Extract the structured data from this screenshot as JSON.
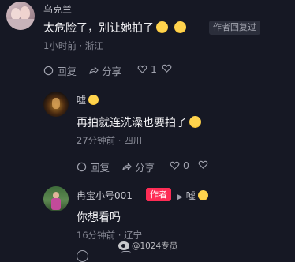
{
  "comments": [
    {
      "username": "乌克兰",
      "text": "太危险了，别让她拍了",
      "emojis": [
        "laughing-crying-emoji",
        "laughing-crying-emoji"
      ],
      "author_badge": "作者回复过",
      "time": "1小时前 · 浙江",
      "actions": {
        "reply": "回复",
        "share": "分享",
        "likes": "1"
      }
    },
    {
      "username": "嘘",
      "text": "再拍就连洗澡也要拍了",
      "emojis": [
        "smile-emoji"
      ],
      "time": "27分钟前 · 四川",
      "actions": {
        "reply": "回复",
        "share": "分享",
        "likes": "0"
      }
    },
    {
      "username": "冉宝小号001",
      "author_tag": "作者",
      "reply_to": "嘘",
      "text": "你想看吗",
      "time": "16分钟前 · 辽宁"
    }
  ],
  "watermark": "@1024专员",
  "colors": {
    "background": "#161824",
    "author_badge": "#fe2c55",
    "meta_text": "#8a8c98"
  }
}
